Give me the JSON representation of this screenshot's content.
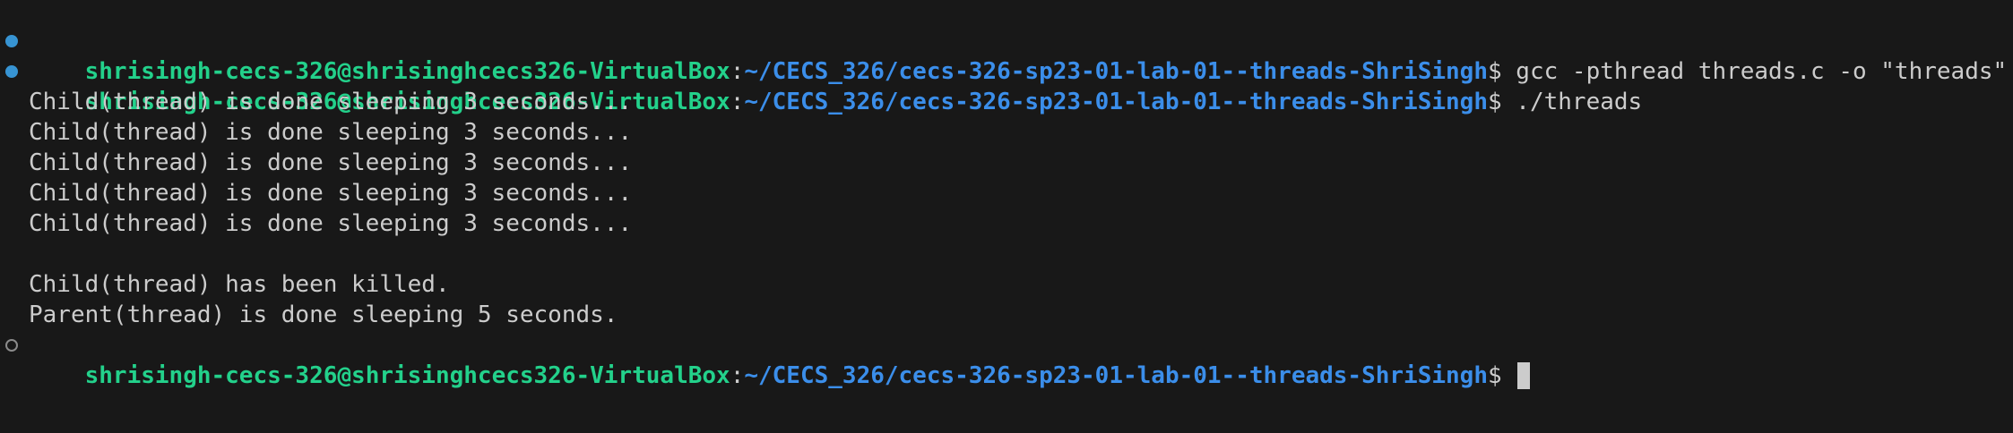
{
  "colors": {
    "background": "#181818",
    "text": "#cccccc",
    "user_host": "#23d18b",
    "path": "#3b8eea",
    "decoration_done": "#3794d3",
    "decoration_pending": "#8b8b8b"
  },
  "prompt": {
    "user_host": "shrisingh-cecs-326@shrisinghcecs326-VirtualBox",
    "separator": ":",
    "path": "~/CECS_326/cecs-326-sp23-01-lab-01--threads-ShriSingh",
    "symbol": "$ "
  },
  "commands": [
    {
      "text": "gcc -pthread threads.c -o \"threads\"",
      "decoration": "done-circle-icon"
    },
    {
      "text": "./threads",
      "decoration": "done-circle-icon"
    }
  ],
  "output": [
    "Child(thread) is done sleeping 3 seconds...",
    "Child(thread) is done sleeping 3 seconds...",
    "Child(thread) is done sleeping 3 seconds...",
    "Child(thread) is done sleeping 3 seconds...",
    "Child(thread) is done sleeping 3 seconds...",
    "",
    "Child(thread) has been killed.",
    "Parent(thread) is done sleeping 5 seconds."
  ],
  "final_prompt": {
    "decoration": "pending-circle-icon",
    "cursor": "block-cursor"
  }
}
